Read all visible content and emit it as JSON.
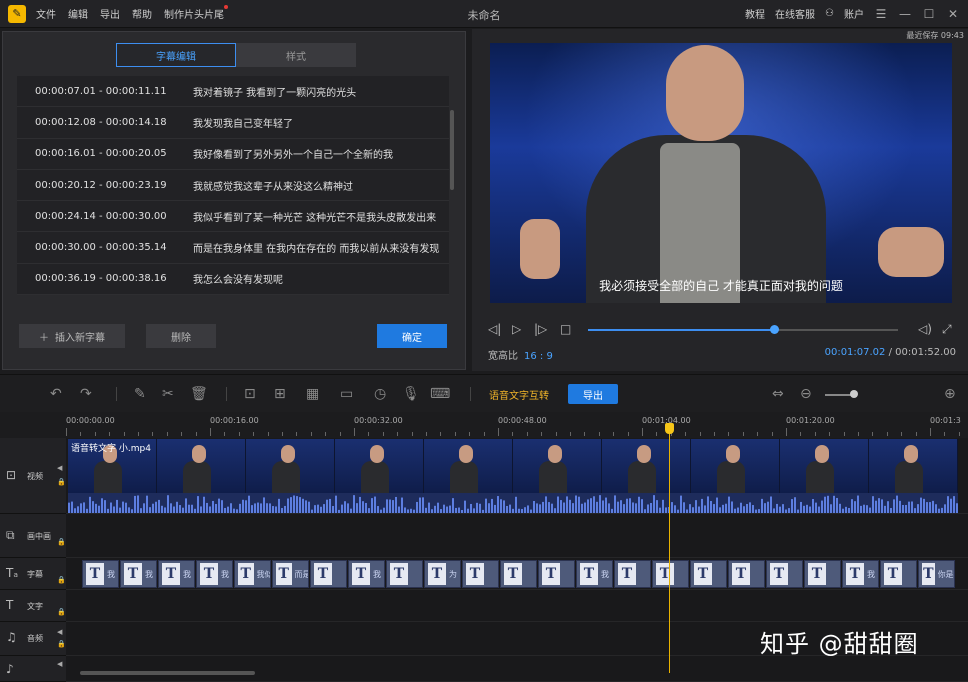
{
  "titlebar": {
    "menu": [
      "文件",
      "编辑",
      "导出",
      "帮助",
      "制作片头片尾"
    ],
    "window_title": "未命名",
    "right": {
      "tutorial": "教程",
      "support": "在线客服",
      "account": "账户"
    }
  },
  "subtitle_panel": {
    "tab_active": "字幕编辑",
    "tab_inactive": "样式",
    "rows": [
      {
        "time": "00:00:07.01 - 00:00:11.11",
        "text": "我对着镜子 我看到了一颗闪亮的光头"
      },
      {
        "time": "00:00:12.08 - 00:00:14.18",
        "text": "我发现我自己变年轻了"
      },
      {
        "time": "00:00:16.01 - 00:00:20.05",
        "text": "我好像看到了另外另外一个自己一个全新的我"
      },
      {
        "time": "00:00:20.12 - 00:00:23.19",
        "text": "我就感觉我这辈子从来没这么精神过"
      },
      {
        "time": "00:00:24.14 - 00:00:30.00",
        "text": "我似乎看到了某一种光芒 这种光芒不是我头皮散发出来"
      },
      {
        "time": "00:00:30.00 - 00:00:35.14",
        "text": "而是在我身体里 在我内在存在的 而我以前从来没有发现"
      },
      {
        "time": "00:00:36.19 - 00:00:38.16",
        "text": "我怎么会没有发现呢"
      }
    ],
    "add_button": "插入新字幕",
    "delete_button": "删除",
    "ok_button": "确定"
  },
  "preview": {
    "saved": "最近保存 09:43",
    "caption": "我必须接受全部的自己 才能真正面对我的问题",
    "ratio_label": "宽高比",
    "ratio_value": "16 : 9",
    "current_time": "00:01:07.02",
    "separator": "/",
    "total_time": "00:01:52.00",
    "progress": 0.6
  },
  "toolbar": {
    "voice_to_text": "语音文字互转",
    "export": "导出"
  },
  "timeline": {
    "ruler": [
      "00:00:00.00",
      "00:00:16.00",
      "00:00:32.00",
      "00:00:48.00",
      "00:01:04.00",
      "00:01:20.00",
      "00:01:3"
    ],
    "tracks": {
      "video": "视频",
      "pip": "画中画",
      "subtitle": "字幕",
      "text": "文字",
      "audio": "音频"
    },
    "video_clip_name": "语音转文字 小.mp4",
    "subtitle_clip_texts": [
      "我",
      "我",
      "我",
      "我",
      "我似",
      "而是",
      "",
      "我",
      "",
      "为",
      "",
      "",
      "",
      "我",
      "",
      "",
      "",
      "",
      "",
      "",
      "我",
      "",
      "你是我"
    ]
  },
  "watermark": "知乎 @甜甜圈"
}
